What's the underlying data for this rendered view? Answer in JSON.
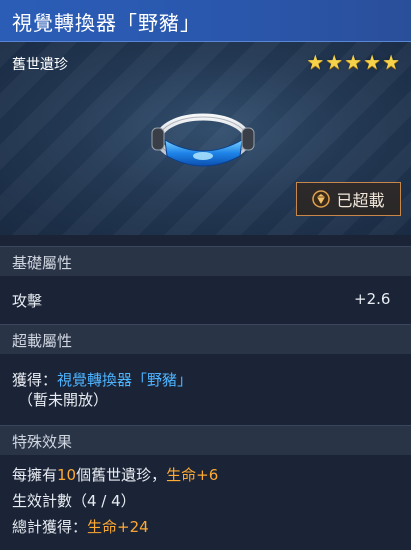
{
  "header": {
    "title": "視覺轉換器「野豬」"
  },
  "card": {
    "rarity": "舊世遺珍",
    "stars": "★★★★★",
    "stars_count": 5,
    "item_icon": "visor-goggles-image",
    "badge": {
      "icon": "gem-icon",
      "label": "已超載"
    }
  },
  "sections": {
    "base": {
      "title": "基礎屬性",
      "stat_name": "攻擊",
      "stat_value": "+2.6"
    },
    "overload": {
      "title": "超載屬性",
      "obtain_prefix": "獲得：",
      "obtain_item": "視覺轉換器「野豬」",
      "status": "（暫未開放）"
    },
    "special": {
      "title": "特殊效果",
      "line1_a": "每擁有",
      "line1_num": "10",
      "line1_b": "個舊世遺珍，",
      "line1_effect": "生命+6",
      "line2": "生效計數（4 / 4）",
      "line3_prefix": "總計獲得：",
      "line3_effect": "生命+24"
    }
  },
  "colors": {
    "header_bg": "#2b5db7",
    "stars": "#f6d24a",
    "highlight_blue": "#4db3ff",
    "highlight_orange": "#ffaa33",
    "badge_border": "#c8874a"
  }
}
